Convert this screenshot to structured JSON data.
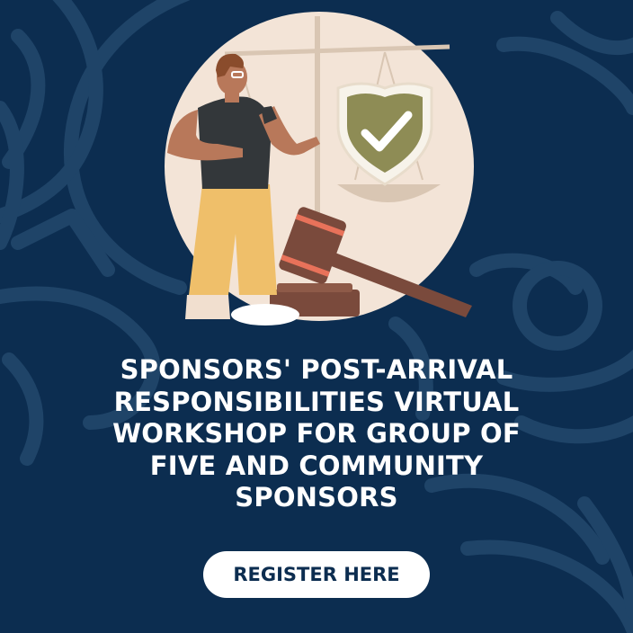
{
  "headline_lines": [
    "SPONSORS' POST-ARRIVAL",
    "RESPONSIBILITIES VIRTUAL",
    "WORKSHOP FOR GROUP OF",
    "FIVE AND COMMUNITY",
    "SPONSORS"
  ],
  "cta": {
    "label": "REGISTER HERE"
  },
  "colors": {
    "background": "#0c2d50",
    "pattern": "#1f4468",
    "circle": "#f3e4d7",
    "text": "#ffffff",
    "button_bg": "#ffffff",
    "button_text": "#0c2d50",
    "shield": "#8e8c55",
    "gavel": "#7a4a3c"
  },
  "icons": {
    "shield": "shield-check-icon",
    "scale": "justice-scale-icon",
    "gavel": "gavel-icon",
    "person": "person-illustration"
  }
}
